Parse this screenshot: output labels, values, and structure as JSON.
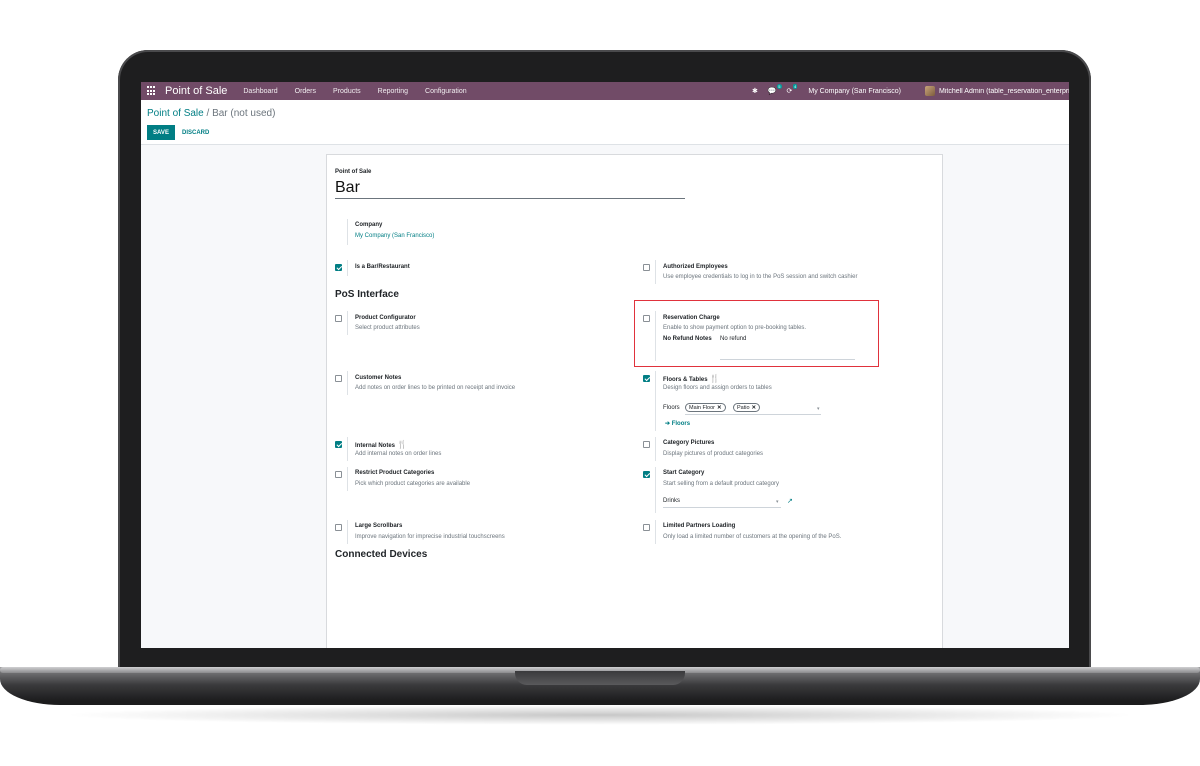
{
  "navbar": {
    "app_title": "Point of Sale",
    "menu": [
      "Dashboard",
      "Orders",
      "Products",
      "Reporting",
      "Configuration"
    ],
    "chat_count": "5",
    "activity_count": "4",
    "company": "My Company (San Francisco)",
    "user": "Mitchell Admin (table_reservation_enterpri"
  },
  "control": {
    "breadcrumb_parent": "Point of Sale",
    "breadcrumb_sep": "/",
    "breadcrumb_current": "Bar (not used)",
    "save_label": "SAVE",
    "discard_label": "DISCARD"
  },
  "form": {
    "name_label": "Point of Sale",
    "name_value": "Bar",
    "company_label": "Company",
    "company_value": "My Company (San Francisco)",
    "bar_restaurant": {
      "label": "Is a Bar/Restaurant",
      "checked": true
    },
    "authorized_employees": {
      "label": "Authorized Employees",
      "desc": "Use employee credentials to log in to the PoS session and switch cashier",
      "checked": false
    },
    "section_interface": "PoS Interface",
    "product_configurator": {
      "label": "Product Configurator",
      "desc": "Select product attributes",
      "checked": false
    },
    "reservation_charge": {
      "label": "Reservation Charge",
      "desc": "Enable to show payment option to pre-booking tables.",
      "checked": false,
      "refund_label": "No Refund Notes",
      "refund_value": "No refund"
    },
    "customer_notes": {
      "label": "Customer Notes",
      "desc": "Add notes on order lines to be printed on receipt and invoice",
      "checked": false
    },
    "floors_tables": {
      "label": "Floors & Tables",
      "desc": "Design floors and assign orders to tables",
      "checked": true,
      "floors_label": "Floors",
      "floor_tags": [
        "Main Floor",
        "Patio"
      ],
      "floors_link": "Floors"
    },
    "internal_notes": {
      "label": "Internal Notes",
      "desc": "Add internal notes on order lines",
      "checked": true
    },
    "category_pictures": {
      "label": "Category Pictures",
      "desc": "Display pictures of product categories",
      "checked": false
    },
    "restrict_categories": {
      "label": "Restrict Product Categories",
      "desc": "Pick which product categories are available",
      "checked": false
    },
    "start_category": {
      "label": "Start Category",
      "desc": "Start selling from a default product category",
      "checked": true,
      "value": "Drinks"
    },
    "large_scrollbars": {
      "label": "Large Scrollbars",
      "desc": "Improve navigation for imprecise industrial touchscreens",
      "checked": false
    },
    "limited_partners": {
      "label": "Limited Partners Loading",
      "desc": "Only load a limited number of customers at the opening of the PoS.",
      "checked": false
    },
    "section_devices": "Connected Devices"
  },
  "colors": {
    "navbar": "#714b67",
    "accent": "#017e84",
    "highlight": "#e0323c"
  }
}
